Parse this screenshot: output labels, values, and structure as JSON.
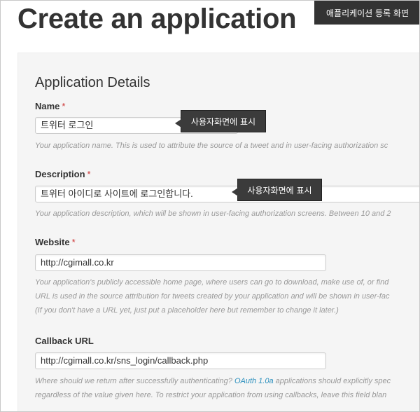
{
  "header": {
    "title": "Create an application",
    "badge": "애플리케이션 등록 화면"
  },
  "section": {
    "title": "Application Details"
  },
  "fields": {
    "name": {
      "label": "Name",
      "required": "*",
      "value": "트위터 로그인",
      "hint": "Your application name. This is used to attribute the source of a tweet and in user-facing authorization sc",
      "tooltip": "사용자화면에 표시"
    },
    "description": {
      "label": "Description",
      "required": "*",
      "value": "트위터 아이디로 사이트에 로그인합니다.",
      "hint": "Your application description, which will be shown in user-facing authorization screens. Between 10 and 2",
      "tooltip": "사용자화면에 표시"
    },
    "website": {
      "label": "Website",
      "required": "*",
      "value": "http://cgimall.co.kr",
      "hint_lines": [
        "Your application's publicly accessible home page, where users can go to download, make use of, or find",
        "URL is used in the source attribution for tweets created by your application and will be shown in user-fac",
        "(If you don't have a URL yet, just put a placeholder here but remember to change it later.)"
      ]
    },
    "callback": {
      "label": "Callback URL",
      "value": "http://cgimall.co.kr/sns_login/callback.php",
      "hint_line1_before": "Where should we return after successfully authenticating? ",
      "hint_link": "OAuth 1.0a",
      "hint_line1_after": " applications should explicitly spec",
      "hint_line2": "regardless of the value given here. To restrict your application from using callbacks, leave this field blan"
    }
  }
}
